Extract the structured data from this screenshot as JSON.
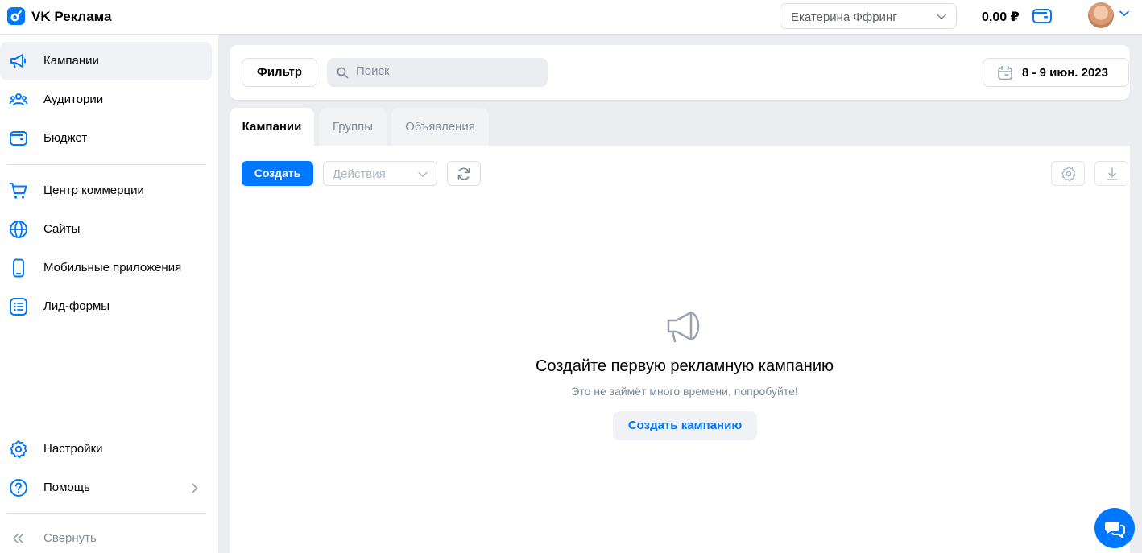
{
  "app": {
    "title": "VK Реклама"
  },
  "header": {
    "account": "Екатерина Ффринг",
    "balance": "0,00 ₽"
  },
  "sidebar": {
    "items": [
      {
        "label": "Кампании",
        "icon": "megaphone-icon",
        "active": true
      },
      {
        "label": "Аудитории",
        "icon": "users-icon"
      },
      {
        "label": "Бюджет",
        "icon": "wallet-icon"
      },
      {
        "label": "Центр коммерции",
        "icon": "cart-icon"
      },
      {
        "label": "Сайты",
        "icon": "globe-icon"
      },
      {
        "label": "Мобильные приложения",
        "icon": "phone-icon"
      },
      {
        "label": "Лид-формы",
        "icon": "list-icon"
      }
    ],
    "bottom": [
      {
        "label": "Настройки",
        "icon": "gear-icon"
      },
      {
        "label": "Помощь",
        "icon": "question-icon"
      }
    ],
    "collapse_label": "Свернуть"
  },
  "filterbar": {
    "filter_label": "Фильтр",
    "search_placeholder": "Поиск",
    "date_range": "8 - 9 июн. 2023"
  },
  "tabs": [
    {
      "label": "Кампании",
      "active": true
    },
    {
      "label": "Группы"
    },
    {
      "label": "Объявления"
    }
  ],
  "toolbar": {
    "create_label": "Создать",
    "actions_placeholder": "Действия"
  },
  "empty_state": {
    "title": "Создайте первую рекламную кампанию",
    "subtitle": "Это не займёт много времени, попробуйте!",
    "button": "Создать кампанию"
  },
  "colors": {
    "accent": "#0077ff",
    "text_secondary": "#818c99",
    "background": "#ebedf0"
  }
}
